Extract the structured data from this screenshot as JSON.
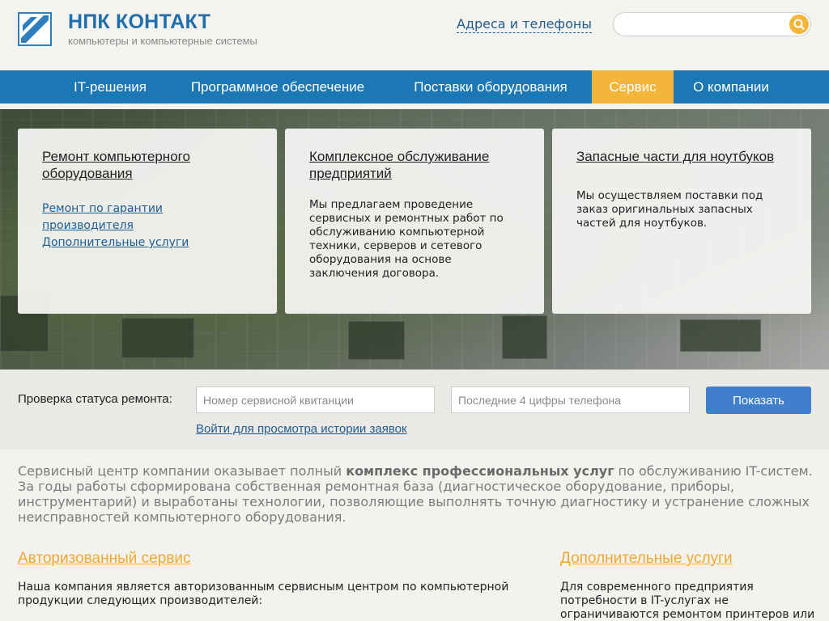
{
  "header": {
    "brand_title": "НПК КОНТАКТ",
    "brand_subtitle": "компьютеры и компьютерные системы",
    "logo_text": "КОНТАКТ",
    "contacts_link": "Адреса и телефоны",
    "search_placeholder": ""
  },
  "nav": {
    "items": [
      {
        "label": "IT-решения",
        "active": false
      },
      {
        "label": "Программное обеспечение",
        "active": false
      },
      {
        "label": "Поставки оборудования",
        "active": false
      },
      {
        "label": "Сервис",
        "active": true
      },
      {
        "label": "О компании",
        "active": false
      }
    ]
  },
  "cards": [
    {
      "title": "Ремонт компьютерного оборудования",
      "links": [
        "Ремонт по гарантии производителя",
        "Дополнительные услуги"
      ]
    },
    {
      "title": "Комплексное обслуживание предприятий",
      "text": "Мы предлагаем проведение сервисных и ремонтных работ по обслуживанию компьютерной техники, серверов и сетевого оборудования на основе заключения договора."
    },
    {
      "title": "Запасные части для ноутбуков",
      "text": "Мы осуществляем поставки под заказ оригинальных запасных частей для ноутбуков."
    }
  ],
  "repair_status": {
    "label": "Проверка статуса ремонта:",
    "receipt_placeholder": "Номер сервисной квитанции",
    "phone_placeholder": "Последние 4 цифры телефона",
    "button_label": "Показать",
    "history_link": "Войти для просмотра истории заявок"
  },
  "intro": {
    "text_before": "Сервисный центр компании оказывает полный ",
    "text_bold": "комплекс профессиональных услуг",
    "text_after": " по обслуживанию IT-систем. За годы работы сформирована собственная ремонтная база (диагностическое оборудование, приборы, инструментарий) и выработаны технологии, позволяющие выполнять точную диагностику и устранение сложных неисправностей компьютерного оборудования."
  },
  "sections": {
    "authorized": {
      "title": "Авторизованный сервис",
      "text": "Наша компания является авторизованным сервисным центром по компьютерной продукции следующих производителей:"
    },
    "extra": {
      "title": "Дополнительные услуги",
      "text": "Для современного предприятия потребности в IT-услугах не ограничиваются ремонтом принтеров или"
    }
  },
  "colors": {
    "brand": "#1f6fae",
    "nav_bg": "#1c78b5",
    "nav_active": "#f4b53c",
    "button": "#3f7fcc",
    "section_title": "#f0a830"
  }
}
